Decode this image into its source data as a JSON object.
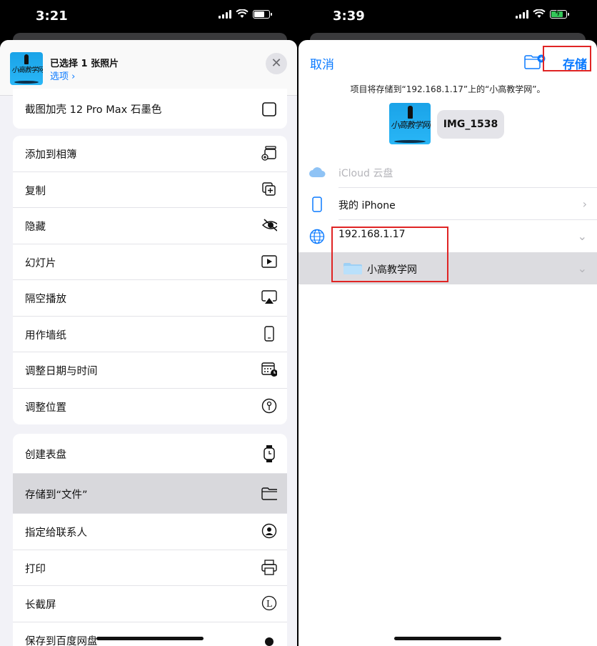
{
  "left": {
    "status": {
      "time": "3:21"
    },
    "header": {
      "title": "已选择 1 张照片",
      "options": "选项 ›"
    },
    "row_top": {
      "label": "截图加壳 12 Pro Max 石墨色"
    },
    "group1": [
      "添加到相簿",
      "复制",
      "隐藏",
      "幻灯片",
      "隔空播放",
      "用作墙纸",
      "调整日期与时间",
      "调整位置"
    ],
    "group2": [
      "创建表盘",
      "存储到“文件”",
      "指定给联系人",
      "打印",
      "长截屏",
      "保存到百度网盘"
    ]
  },
  "right": {
    "status": {
      "time": "3:39"
    },
    "cancel": "取消",
    "save": "存储",
    "info": "项目将存储到“192.168.1.17”上的“小高教学网”。",
    "filename": "IMG_1538",
    "locations": [
      {
        "label": "iCloud 云盘"
      },
      {
        "label": "我的 iPhone"
      },
      {
        "label": "192.168.1.17"
      },
      {
        "label": "小高教学网"
      }
    ]
  },
  "colors": {
    "accent": "#0a7aff",
    "highlight_box": "#e02424"
  }
}
